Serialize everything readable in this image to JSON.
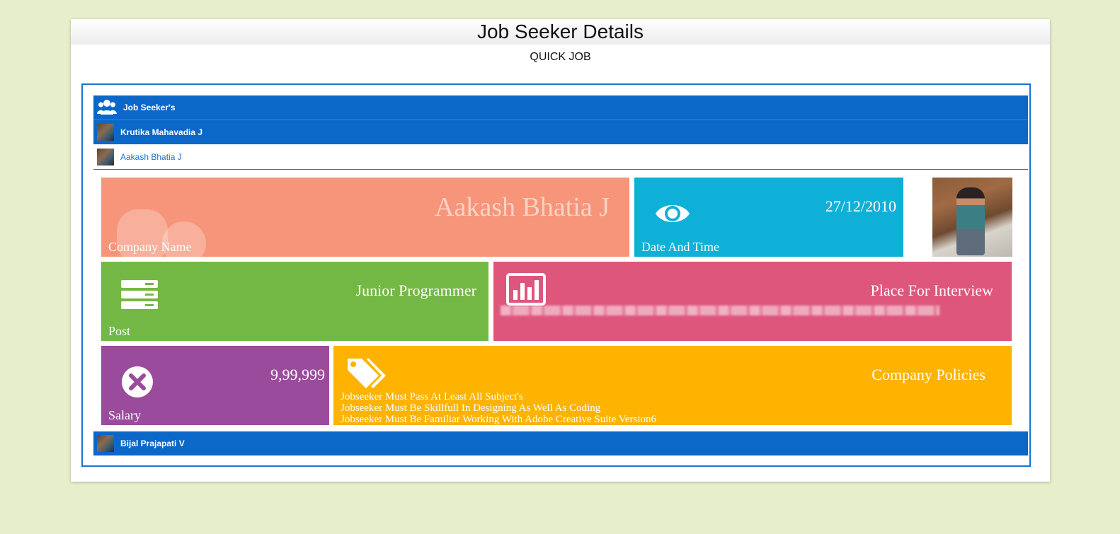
{
  "page": {
    "title": "Job Seeker Details",
    "subtitle": "QUICK JOB"
  },
  "list": {
    "header_label": "Job Seeker's",
    "items": [
      {
        "name": "Krutika Mahavadia J"
      },
      {
        "name": "Aakash Bhatia J"
      },
      {
        "name": "Bijal Prajapati V"
      }
    ]
  },
  "details": {
    "company": {
      "value": "Aakash Bhatia J",
      "label": "Company Name"
    },
    "date": {
      "value": "27/12/2010",
      "label": "Date And Time"
    },
    "post": {
      "value": "Junior Programmer",
      "label": "Post"
    },
    "place": {
      "value": "Place For Interview"
    },
    "salary": {
      "value": "9,99,999",
      "label": "Salary"
    },
    "policies": {
      "value": "Company Policies",
      "lines": [
        "Jobseeker Must Pass At Least All Subject's",
        "Jobseeker Must Be Skillfull In Designing As Well As Coding",
        "Jobseeker Must Be Familiar Working With Adobe Creative Suite Version6"
      ]
    }
  },
  "colors": {
    "background": "#e7eecb",
    "list_blue": "#0b67c8",
    "company_tile": "#f6957a",
    "date_tile": "#0fb0d8",
    "post_tile": "#73b845",
    "place_tile": "#de567c",
    "salary_tile": "#9b4b9b",
    "policy_tile": "#fdb300"
  },
  "icons": {
    "header": "users-icon",
    "date": "eye-icon",
    "post": "server-icon",
    "place": "bar-chart-icon",
    "salary": "close-circle-icon",
    "policies": "tags-icon"
  }
}
